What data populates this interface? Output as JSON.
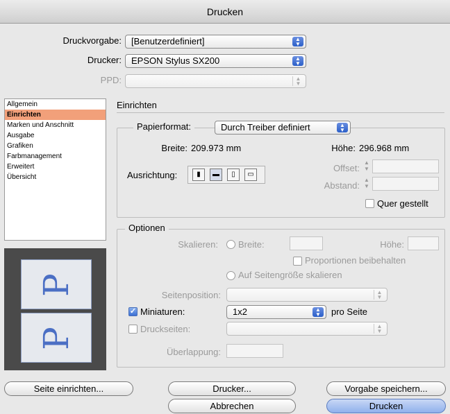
{
  "window": {
    "title": "Drucken"
  },
  "top": {
    "preset_label": "Druckvorgabe:",
    "preset_value": "[Benutzerdefiniert]",
    "printer_label": "Drucker:",
    "printer_value": "EPSON Stylus SX200",
    "ppd_label": "PPD:",
    "ppd_value": ""
  },
  "sidebar": {
    "items": [
      {
        "label": "Allgemein"
      },
      {
        "label": "Einrichten"
      },
      {
        "label": "Marken und Anschnitt"
      },
      {
        "label": "Ausgabe"
      },
      {
        "label": "Grafiken"
      },
      {
        "label": "Farbmanagement"
      },
      {
        "label": "Erweitert"
      },
      {
        "label": "Übersicht"
      }
    ],
    "selected": "Einrichten"
  },
  "setup": {
    "section_title": "Einrichten",
    "paper_format_label": "Papierformat:",
    "paper_format_value": "Durch Treiber definiert",
    "width_label": "Breite:",
    "width_value": "209.973 mm",
    "height_label": "Höhe:",
    "height_value": "296.968 mm",
    "orientation_label": "Ausrichtung:",
    "offset_label": "Offset:",
    "gap_label": "Abstand:",
    "transverse_label": "Quer gestellt"
  },
  "options": {
    "legend": "Optionen",
    "scale_label": "Skalieren:",
    "scale_width_label": "Breite:",
    "scale_height_label": "Höhe:",
    "keep_proportions_label": "Proportionen beibehalten",
    "fit_page_label": "Auf Seitengröße skalieren",
    "page_position_label": "Seitenposition:",
    "thumbnails_label": "Miniaturen:",
    "thumbnails_checked": true,
    "thumbnails_value": "1x2",
    "per_page_label": "pro Seite",
    "tile_label": "Druckseiten:",
    "overlap_label": "Überlappung:"
  },
  "preview": {
    "glyph": "P"
  },
  "buttons": {
    "page_setup": "Seite einrichten...",
    "printer": "Drucker...",
    "save_preset": "Vorgabe speichern...",
    "cancel": "Abbrechen",
    "print": "Drucken"
  }
}
